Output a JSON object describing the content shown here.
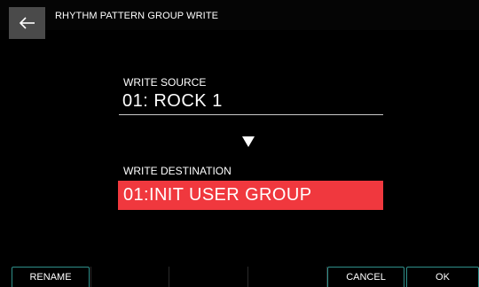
{
  "header": {
    "back_icon": "arrow-left-icon",
    "title": "RHYTHM PATTERN GROUP WRITE"
  },
  "write_source": {
    "label": "WRITE SOURCE",
    "value": "01: ROCK 1"
  },
  "arrow_icon": "triangle-down-icon",
  "write_destination": {
    "label": "WRITE DESTINATION",
    "value": "01:INIT USER GROUP",
    "highlight_color": "#f0383e"
  },
  "footer": {
    "rename_label": "RENAME",
    "cancel_label": "CANCEL",
    "ok_label": "OK",
    "accent_color": "#2f8f8a"
  }
}
